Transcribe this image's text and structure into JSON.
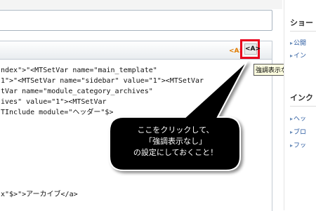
{
  "editor": {
    "code_lines": [
      "ndex\">\"<MTSetVar name=\"main_template\"",
      "1\">\"<MTSetVar name=\"sidebar\" value=\"1\"><MTSetVar",
      "tVar name=\"module_category_archives\"",
      "ives\" value=\"1\"><MTSetVar",
      "TInclude module=\"ヘッダー\"$>",
      "x\"$>\">アーカイブ</a>"
    ]
  },
  "toolbar": {
    "emphasis_on_label": "<A>",
    "emphasis_off_label": "<A>",
    "tooltip": "強調表示なし"
  },
  "sidebar": {
    "heading1": "ショー",
    "items1": [
      "公開",
      "イン"
    ],
    "heading2": "インク",
    "items2": [
      "ヘッ",
      "ブロ",
      "フッ"
    ]
  },
  "callout": {
    "lines": [
      "ここをクリックして、",
      "「強調表示なし」",
      "の設定にしておくこと！"
    ]
  },
  "colors": {
    "highlight_border": "#e8001c",
    "callout_fill": "#000000",
    "link": "#2a5aa0"
  }
}
